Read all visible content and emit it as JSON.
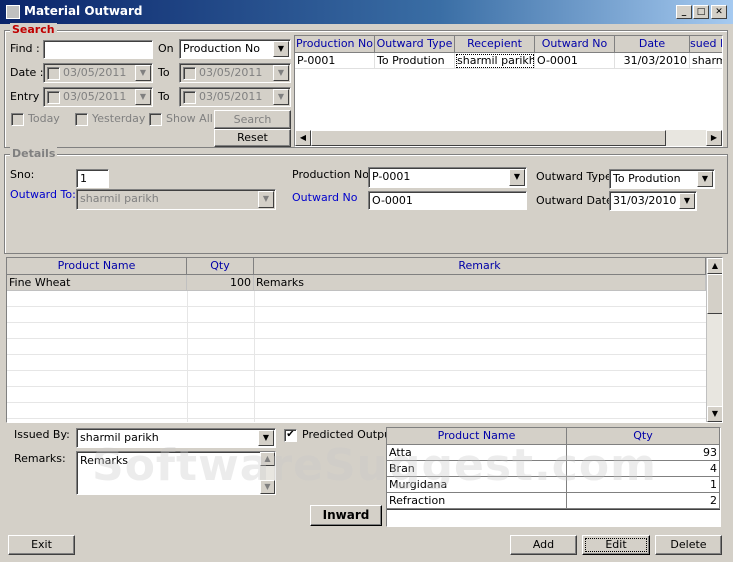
{
  "window": {
    "title": "Material Outward",
    "min": "_",
    "max": "□",
    "close": "✕"
  },
  "search": {
    "legend": "Search",
    "find_label": "Find :",
    "find_value": "",
    "on_label": "On",
    "on_value": "Production No",
    "date_label": "Date :",
    "date_from": "03/05/2011",
    "to_label": "To",
    "date_to": "03/05/2011",
    "entry_label": "Entry :",
    "entry_from": "03/05/2011",
    "entry_to": "03/05/2011",
    "today_label": "Today",
    "yesterday_label": "Yesterday",
    "showall_label": "Show All",
    "search_button": "Search",
    "reset_button": "Reset",
    "results": {
      "columns": [
        "Production No",
        "Outward Type",
        "Recepient",
        "Outward No",
        "Date",
        "sued E"
      ],
      "rows": [
        [
          "P-0001",
          "To Prodution",
          "sharmil parikh",
          "O-0001",
          "31/03/2010",
          "sharm"
        ]
      ]
    }
  },
  "details": {
    "legend": "Details",
    "sno_label": "Sno:",
    "sno_value": "1",
    "outward_to_label": "Outward To:",
    "outward_to_value": "sharmil parikh",
    "production_no_label": "Production No:",
    "production_no_value": "P-0001",
    "outward_no_label": "Outward No",
    "outward_no_value": "O-0001",
    "outward_type_label": "Outward Type:",
    "outward_type_value": "To Prodution",
    "outward_date_label": "Outward Date:",
    "outward_date_value": "31/03/2010"
  },
  "products": {
    "columns": [
      "Product Name",
      "Qty",
      "Remark"
    ],
    "rows": [
      [
        "Fine Wheat",
        "100",
        "Remarks"
      ]
    ]
  },
  "footer": {
    "issued_by_label": "Issued By:",
    "issued_by_value": "sharmil parikh",
    "predicted_output_label": "Predicted Output",
    "remarks_label": "Remarks:",
    "remarks_value": "Remarks",
    "inward_button": "Inward",
    "output": {
      "columns": [
        "Product Name",
        "Qty"
      ],
      "rows": [
        [
          "Atta",
          "93"
        ],
        [
          "Bran",
          "4"
        ],
        [
          "Murgidana",
          "1"
        ],
        [
          "Refraction",
          "2"
        ]
      ]
    }
  },
  "actions": {
    "exit": "Exit",
    "add": "Add",
    "edit": "Edit",
    "delete": "Delete"
  },
  "watermark": "SoftwareSuggest.com"
}
